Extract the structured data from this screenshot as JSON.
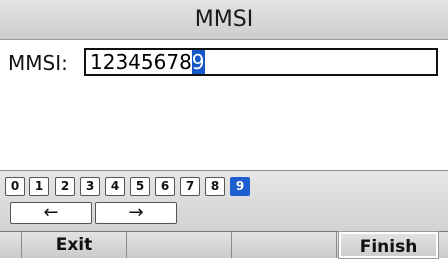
{
  "title": "MMSI",
  "field": {
    "label": "MMSI:",
    "value_prefix": "12345678",
    "value_cursor": "9"
  },
  "keypad": {
    "keys": [
      "0",
      "1",
      "2",
      "3",
      "4",
      "5",
      "6",
      "7",
      "8",
      "9"
    ],
    "selected": "9",
    "left_arrow": "←",
    "right_arrow": "→"
  },
  "softkeys": {
    "exit": "Exit",
    "blank1": "",
    "blank2": "",
    "finish": "Finish"
  },
  "colors": {
    "accent": "#1f5fd0",
    "cursor": "#1559c6"
  }
}
